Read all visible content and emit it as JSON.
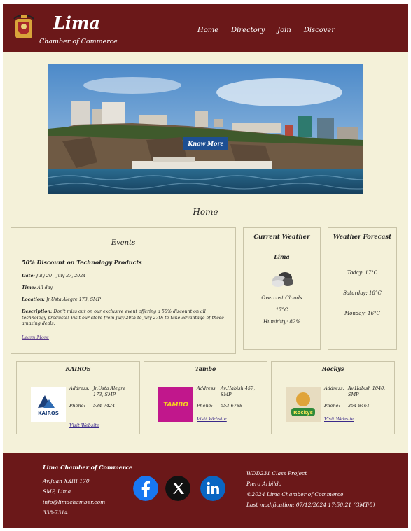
{
  "header": {
    "brand_name": "Lima",
    "brand_sub": "Chamber of Commerce",
    "nav": [
      "Home",
      "Directory",
      "Join",
      "Discover"
    ]
  },
  "hero": {
    "button": "Know More"
  },
  "page_title": "Home",
  "events": {
    "heading": "Events",
    "title": "50% Discount on Technology Products",
    "date_label": "Date:",
    "date": "July 20 - July 27, 2024",
    "time_label": "Time:",
    "time": "All day",
    "location_label": "Location:",
    "location": "Jr.Usta Alegre 173, SMP",
    "description_label": "Description:",
    "description": "Don't miss out on our exclusive event offering a 50% discount on all technology products! Visit our store from July 20th to July 27th to take advantage of these amazing deals.",
    "link": "Learn More"
  },
  "weather": {
    "heading": "Current Weather",
    "city": "Lima",
    "condition": "Overcast Clouds",
    "temp": "17°C",
    "humidity": "Humidity: 82%"
  },
  "forecast": {
    "heading": "Weather Forecast",
    "days": [
      "Today: 17°C",
      "Saturday: 18°C",
      "Monday: 16°C"
    ]
  },
  "businesses": [
    {
      "name": "KAIROS",
      "address_label": "Address:",
      "address": "Jr.Usta Alegre 173, SMP",
      "phone_label": "Phone:",
      "phone": "534-7424",
      "link": "Visit Website",
      "logo_text": "KAIROS"
    },
    {
      "name": "Tambo",
      "address_label": "Address:",
      "address": "Av.Habish 457, SMP",
      "phone_label": "Phone:",
      "phone": "553-6788",
      "link": "Visit Website",
      "logo_text": "TAMBO"
    },
    {
      "name": "Rockys",
      "address_label": "Address:",
      "address": "Av.Habish 1040, SMP",
      "phone_label": "Phone:",
      "phone": "354-8461",
      "link": "Visit Website",
      "logo_text": "Rockys"
    }
  ],
  "footer": {
    "org": "Lima Chamber of Commerce",
    "address1": "Av.Juan XXIII 170",
    "address2": "SMP, Lima",
    "email": "info@limachamber.com",
    "phone": "338-7314",
    "project": "WDD231 Class Project",
    "author": "Piero Arbildo",
    "copyright": "©2024 Lima Chamber of Commerce",
    "modified": "Last modification: 07/12/2024 17:50:21 (GMT-5)"
  },
  "colors": {
    "brand": "#6b1819",
    "background": "#f4f1d9",
    "button": "#1d4f93",
    "facebook": "#1877f2",
    "linkedin": "#0a66c2"
  }
}
